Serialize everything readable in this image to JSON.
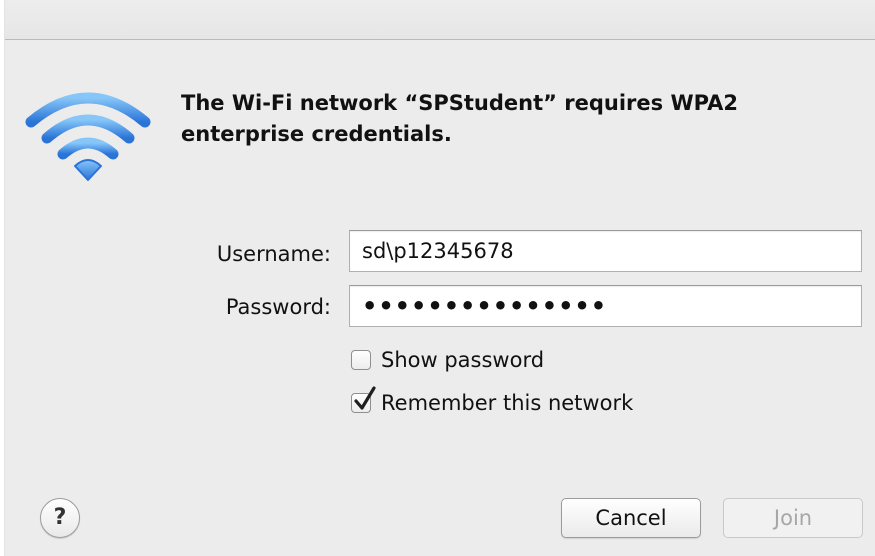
{
  "dialog": {
    "message": "The Wi-Fi network “SPStudent” requires WPA2 enterprise credentials.",
    "icon": "wifi-icon",
    "accent_color": "#2f80e0"
  },
  "form": {
    "username_label": "Username:",
    "username_value": "sd\\p12345678",
    "password_label": "Password:",
    "password_value": "•••••••••••••••",
    "show_password_label": "Show password",
    "show_password_checked": false,
    "remember_label": "Remember this network",
    "remember_checked": true
  },
  "buttons": {
    "help_label": "?",
    "cancel_label": "Cancel",
    "join_label": "Join",
    "join_enabled": false
  }
}
